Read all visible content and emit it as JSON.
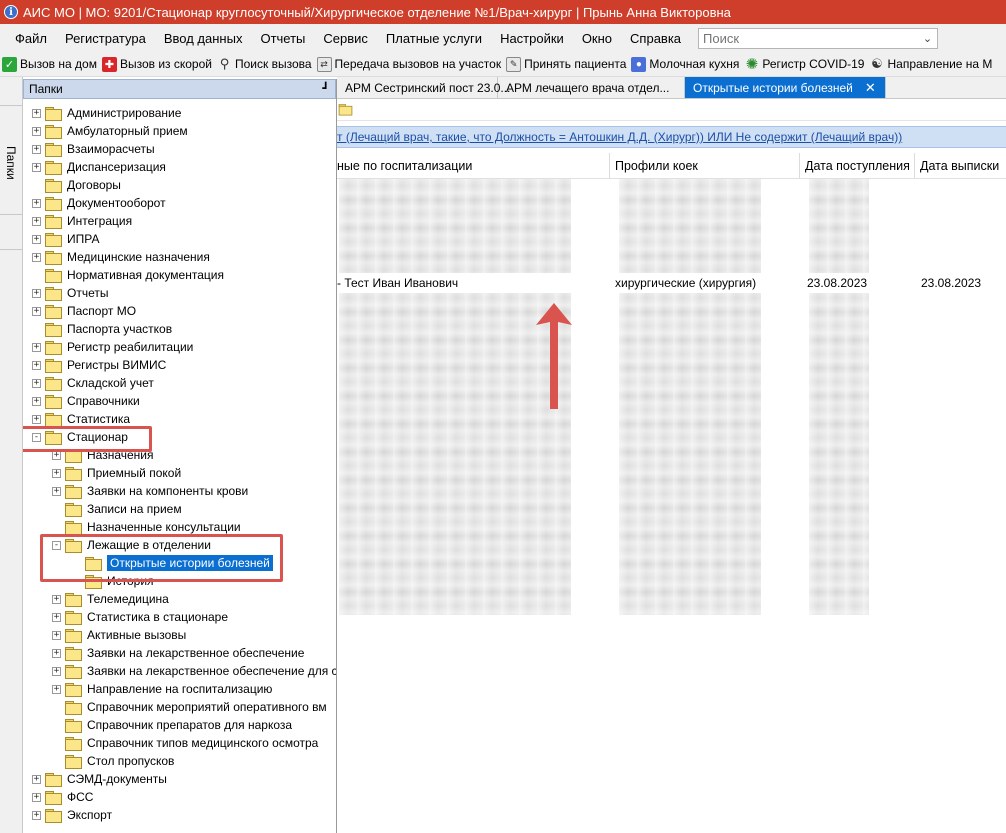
{
  "window": {
    "title": "АИС МО | МО: 9201/Стационар круглосуточный/Хирургическое отделение №1/Врач-хирург | Прынь Анна Викторовна"
  },
  "menubar": {
    "items": [
      "Файл",
      "Регистратура",
      "Ввод данных",
      "Отчеты",
      "Сервис",
      "Платные услуги",
      "Настройки",
      "Окно",
      "Справка"
    ],
    "search_placeholder": "Поиск"
  },
  "toolbar": {
    "items": [
      {
        "label": "Вызов на дом",
        "icon": "check-icon"
      },
      {
        "label": "Вызов из скорой",
        "icon": "ambulance-icon"
      },
      {
        "label": "Поиск вызова",
        "icon": "search-icon"
      },
      {
        "label": "Передача вызовов на участок",
        "icon": "transfer-icon"
      },
      {
        "label": "Принять пациента",
        "icon": "accept-patient-icon"
      },
      {
        "label": "Молочная кухня",
        "icon": "milk-bottle-icon"
      },
      {
        "label": "Регистр COVID-19",
        "icon": "virus-icon"
      },
      {
        "label": "Направление на М",
        "icon": "referral-icon"
      }
    ]
  },
  "side_strip": {
    "tab_label": "Папки"
  },
  "folders_panel": {
    "title": "Папки",
    "tree": [
      {
        "label": "Администрирование",
        "level": 0,
        "expander": "+"
      },
      {
        "label": "Амбулаторный прием",
        "level": 0,
        "expander": "+"
      },
      {
        "label": "Взаиморасчеты",
        "level": 0,
        "expander": "+"
      },
      {
        "label": "Диспансеризация",
        "level": 0,
        "expander": "+"
      },
      {
        "label": "Договоры",
        "level": 0,
        "expander": ""
      },
      {
        "label": "Документооборот",
        "level": 0,
        "expander": "+"
      },
      {
        "label": "Интеграция",
        "level": 0,
        "expander": "+"
      },
      {
        "label": "ИПРА",
        "level": 0,
        "expander": "+"
      },
      {
        "label": "Медицинские назначения",
        "level": 0,
        "expander": "+"
      },
      {
        "label": "Нормативная документация",
        "level": 0,
        "expander": ""
      },
      {
        "label": "Отчеты",
        "level": 0,
        "expander": "+"
      },
      {
        "label": "Паспорт МО",
        "level": 0,
        "expander": "+"
      },
      {
        "label": "Паспорта участков",
        "level": 0,
        "expander": ""
      },
      {
        "label": "Регистр реабилитации",
        "level": 0,
        "expander": "+"
      },
      {
        "label": "Регистры ВИМИС",
        "level": 0,
        "expander": "+"
      },
      {
        "label": "Складской учет",
        "level": 0,
        "expander": "+"
      },
      {
        "label": "Справочники",
        "level": 0,
        "expander": "+"
      },
      {
        "label": "Статистика",
        "level": 0,
        "expander": "+"
      },
      {
        "label": "Стационар",
        "level": 0,
        "expander": "-"
      },
      {
        "label": "Назначения",
        "level": 1,
        "expander": "+"
      },
      {
        "label": "Приемный покой",
        "level": 1,
        "expander": "+"
      },
      {
        "label": "Заявки на компоненты крови",
        "level": 1,
        "expander": "+"
      },
      {
        "label": "Записи на прием",
        "level": 1,
        "expander": ""
      },
      {
        "label": "Назначенные консультации",
        "level": 1,
        "expander": ""
      },
      {
        "label": "Лежащие в отделении",
        "level": 1,
        "expander": "-"
      },
      {
        "label": "Открытые истории болезней",
        "level": 2,
        "expander": "",
        "selected": true
      },
      {
        "label": "История",
        "level": 2,
        "expander": ""
      },
      {
        "label": "Телемедицина",
        "level": 1,
        "expander": "+"
      },
      {
        "label": "Статистика в стационаре",
        "level": 1,
        "expander": "+"
      },
      {
        "label": "Активные вызовы",
        "level": 1,
        "expander": "+"
      },
      {
        "label": "Заявки на лекарственное обеспечение",
        "level": 1,
        "expander": "+"
      },
      {
        "label": "Заявки на лекарственное обеспечение для с",
        "level": 1,
        "expander": "+"
      },
      {
        "label": "Направление на госпитализацию",
        "level": 1,
        "expander": "+"
      },
      {
        "label": "Справочник мероприятий оперативного вм",
        "level": 1,
        "expander": ""
      },
      {
        "label": "Справочник препаратов для наркоза",
        "level": 1,
        "expander": ""
      },
      {
        "label": "Справочник типов медицинского осмотра",
        "level": 1,
        "expander": ""
      },
      {
        "label": "Стол пропусков",
        "level": 1,
        "expander": ""
      },
      {
        "label": "СЭМД-документы",
        "level": 0,
        "expander": "+"
      },
      {
        "label": "ФСС",
        "level": 0,
        "expander": "+"
      },
      {
        "label": "Экспорт",
        "level": 0,
        "expander": "+"
      }
    ]
  },
  "tabs": [
    {
      "label": "АРМ Сестринский пост 23.0...",
      "active": false
    },
    {
      "label": "АРМ лечащего врача отдел...",
      "active": false
    },
    {
      "label": "Открытые истории болезней",
      "active": true
    }
  ],
  "filter": {
    "text": "т (Лечащий врач, такие, что Должность = Антошкин Д.Д. (Хирург)) ИЛИ Не содержит (Лечащий врач))"
  },
  "grid": {
    "columns": [
      "ные по госпитализации",
      "Профили коек",
      "Дата поступления",
      "Дата выписки"
    ],
    "visible_row": {
      "patient": "- Тест Иван Иванович",
      "bed_profile": "хирургические (хирургия)",
      "admission_date": "23.08.2023",
      "discharge_date": "23.08.2023"
    }
  },
  "colors": {
    "title_bar": "#cf3e2a",
    "selection": "#0a6fd1",
    "annotation": "#d9534f",
    "filter_bg": "#cfe0f4"
  }
}
